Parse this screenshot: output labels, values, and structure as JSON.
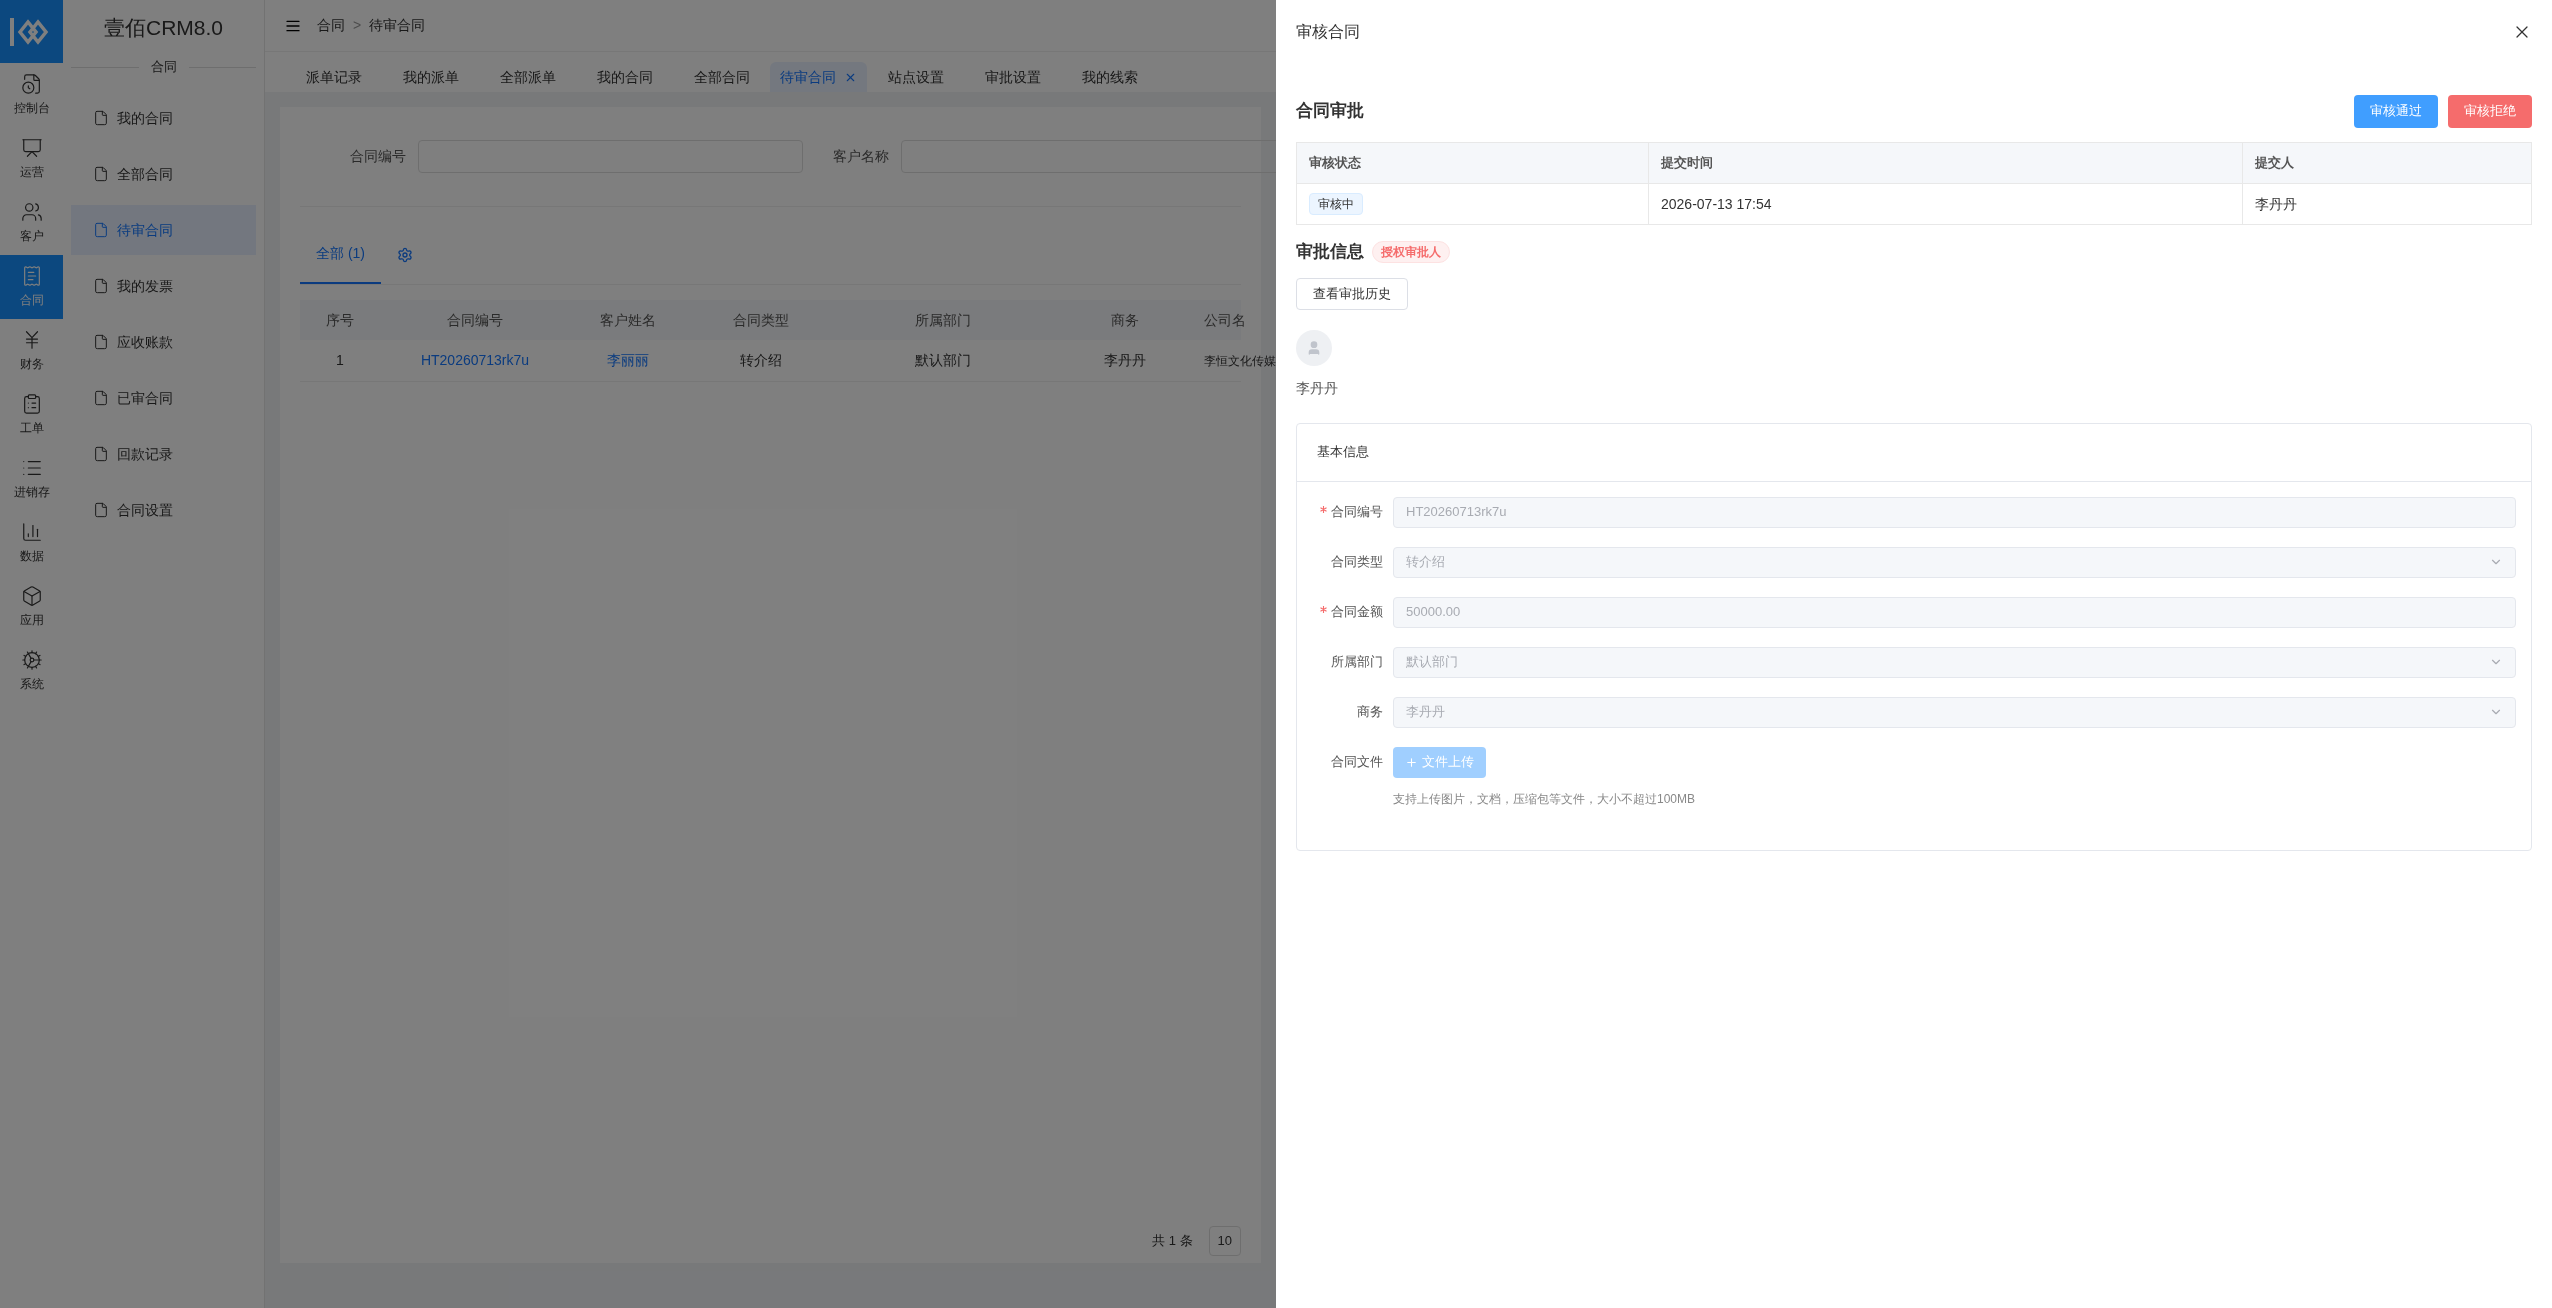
{
  "app_title": "壹佰CRM8.0",
  "rail": [
    {
      "label": "控制台",
      "selected": false
    },
    {
      "label": "运营",
      "selected": false
    },
    {
      "label": "客户",
      "selected": false
    },
    {
      "label": "合同",
      "selected": true
    },
    {
      "label": "财务",
      "selected": false
    },
    {
      "label": "工单",
      "selected": false
    },
    {
      "label": "进销存",
      "selected": false
    },
    {
      "label": "数据",
      "selected": false
    },
    {
      "label": "应用",
      "selected": false
    },
    {
      "label": "系统",
      "selected": false
    }
  ],
  "sidebar": {
    "section": "合同",
    "items": [
      {
        "label": "我的合同",
        "selected": false
      },
      {
        "label": "全部合同",
        "selected": false
      },
      {
        "label": "待审合同",
        "selected": true
      },
      {
        "label": "我的发票",
        "selected": false
      },
      {
        "label": "应收账款",
        "selected": false
      },
      {
        "label": "已审合同",
        "selected": false
      },
      {
        "label": "回款记录",
        "selected": false
      },
      {
        "label": "合同设置",
        "selected": false
      }
    ]
  },
  "breadcrumb": [
    "合同",
    "待审合同"
  ],
  "breadcrumb_separator": ">",
  "tabs": [
    {
      "label": "派单记录",
      "selected": false
    },
    {
      "label": "我的派单",
      "selected": false
    },
    {
      "label": "全部派单",
      "selected": false
    },
    {
      "label": "我的合同",
      "selected": false
    },
    {
      "label": "全部合同",
      "selected": false
    },
    {
      "label": "待审合同",
      "selected": true
    },
    {
      "label": "站点设置",
      "selected": false
    },
    {
      "label": "审批设置",
      "selected": false
    },
    {
      "label": "我的线索",
      "selected": false
    }
  ],
  "filters": [
    {
      "label": "合同编号"
    },
    {
      "label": "客户名称"
    }
  ],
  "list_tabs": [
    {
      "label": "全部 (1)",
      "selected": true
    }
  ],
  "table": {
    "columns": [
      "序号",
      "合同编号",
      "客户姓名",
      "合同类型",
      "所属部门",
      "商务",
      "公司名"
    ],
    "rows": [
      [
        {
          "text": "1",
          "kind": "text"
        },
        {
          "text": "HT20260713rk7u",
          "kind": "link"
        },
        {
          "text": "李丽丽",
          "kind": "link"
        },
        {
          "text": "转介绍",
          "kind": "text"
        },
        {
          "text": "默认部门",
          "kind": "text"
        },
        {
          "text": "李丹丹",
          "kind": "text"
        },
        {
          "text": "李恒文化传媒",
          "kind": "text"
        }
      ]
    ]
  },
  "pagination": {
    "total": "共 1 条",
    "page_size": "10"
  },
  "drawer": {
    "title": "审核合同",
    "approval": {
      "heading": "合同审批",
      "buttons": [
        {
          "label": "审核通过",
          "kind": "primary"
        },
        {
          "label": "审核拒绝",
          "kind": "danger"
        }
      ],
      "columns": [
        "审核状态",
        "提交时间",
        "提交人"
      ],
      "rows": [
        [
          {
            "text": "审核中",
            "kind": "tag"
          },
          {
            "text": "2026-07-13 17:54",
            "kind": "text"
          },
          {
            "text": "李丹丹",
            "kind": "text"
          }
        ]
      ]
    },
    "info": {
      "heading": "审批信息",
      "badge": "授权审批人",
      "history_button": "查看审批历史",
      "approver": "李丹丹"
    },
    "basic": {
      "heading": "基本信息",
      "fields": [
        {
          "label": "合同编号",
          "required": true,
          "kind": "input",
          "value": "HT20260713rk7u"
        },
        {
          "label": "合同类型",
          "required": false,
          "kind": "select",
          "value": "转介绍"
        },
        {
          "label": "合同金额",
          "required": true,
          "kind": "input",
          "value": "50000.00"
        },
        {
          "label": "所属部门",
          "required": false,
          "kind": "select",
          "value": "默认部门"
        },
        {
          "label": "商务",
          "required": false,
          "kind": "select",
          "value": "李丹丹"
        },
        {
          "label": "合同文件",
          "required": false,
          "kind": "upload",
          "button": "文件上传",
          "hint": "支持上传图片，文档，压缩包等文件，大小不超过100MB"
        }
      ]
    }
  }
}
